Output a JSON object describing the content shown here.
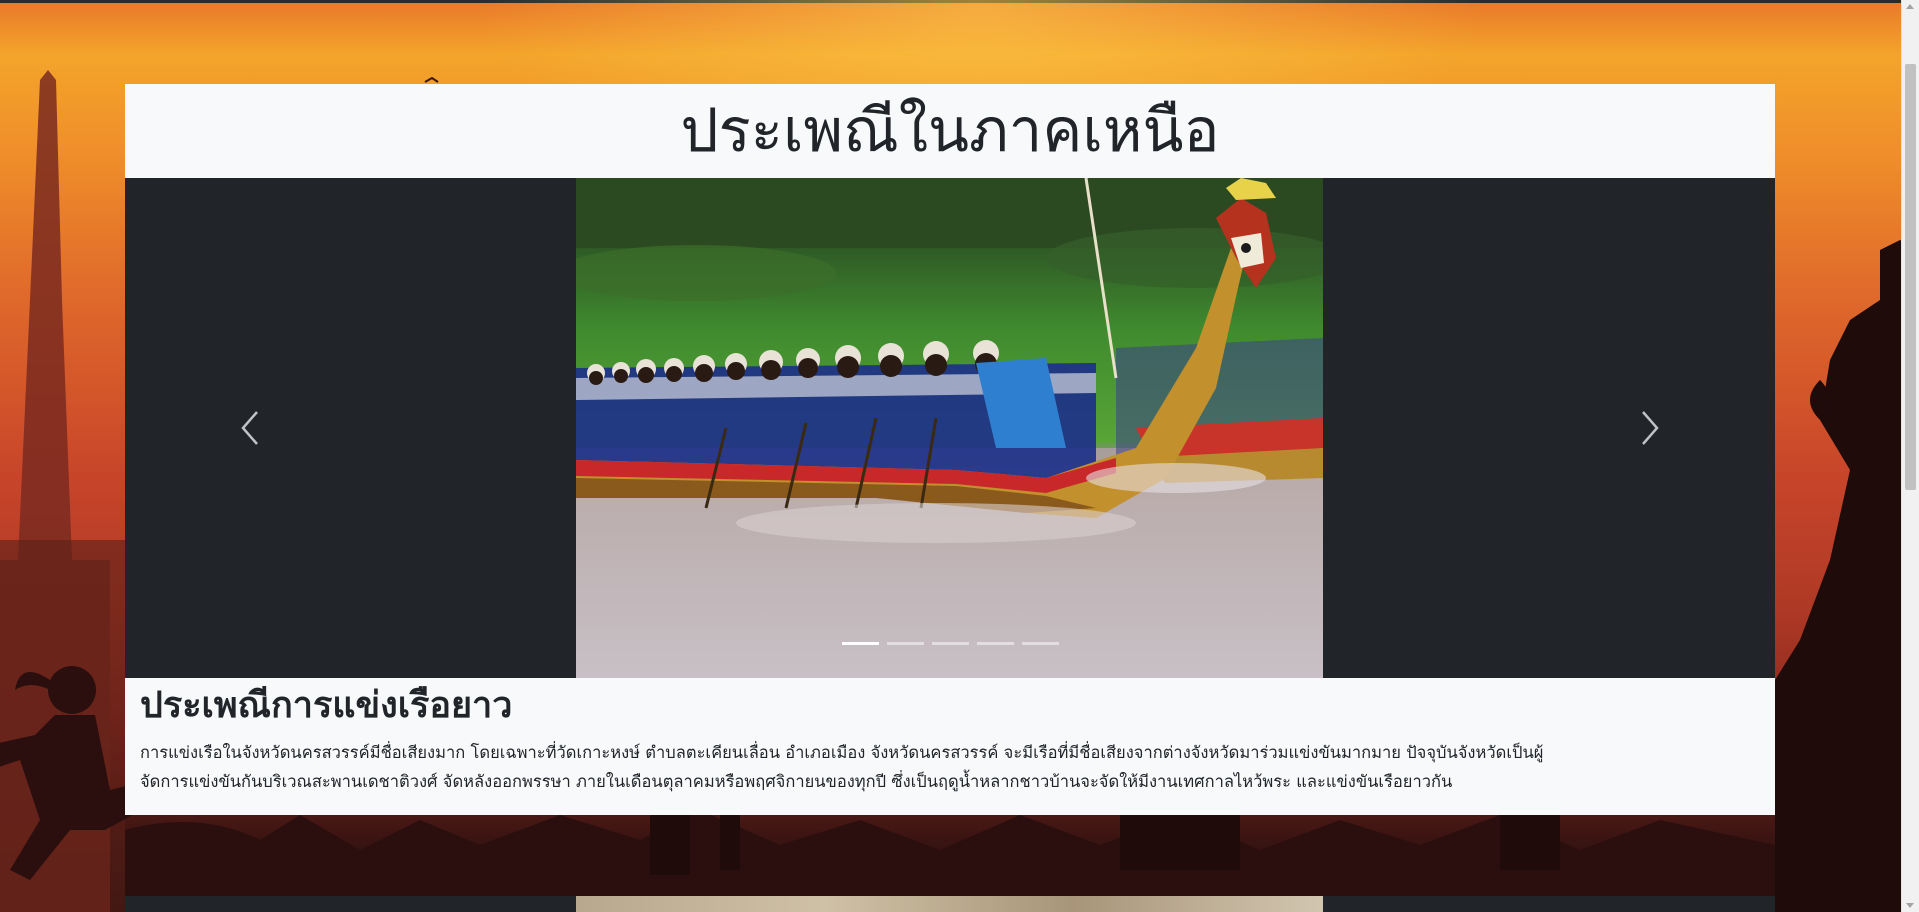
{
  "header": {
    "title": "ประเพณีในภาคเหนือ"
  },
  "carousel": {
    "prev_label": "‹",
    "next_label": "›",
    "slide_count": 5,
    "active_slide": 1,
    "image_alt": "boat-racing-photo"
  },
  "caption": {
    "heading": "ประเพณีการแข่งเรือยาว",
    "body_line1": "การแข่งเรือในจังหวัดนครสวรรค์มีชื่อเสียงมาก โดยเฉพาะที่วัดเกาะหงษ์ ตำบลตะเคียนเลื่อน อำเภอเมือง จังหวัดนครสวรรค์ จะมีเรือที่มีชื่อเสียงจากต่างจังหวัดมาร่วมแข่งขันมากมาย ปัจจุบันจังหวัดเป็นผู้",
    "body_line2": "จัดการแข่งขันกันบริเวณสะพานเดชาติวงศ์ จัดหลังออกพรรษา ภายในเดือนตุลาคมหรือพฤศจิกายนของทุกปี ซึ่งเป็นฤดูน้ำหลากชาวบ้านจะจัดให้มีงานเทศกาลไหว้พระ และแข่งขันเรือยาวกัน"
  },
  "colors": {
    "card_bg": "#f8f9fa",
    "carousel_bg": "#212529",
    "text": "#212529",
    "indicator": "#ffffff"
  }
}
